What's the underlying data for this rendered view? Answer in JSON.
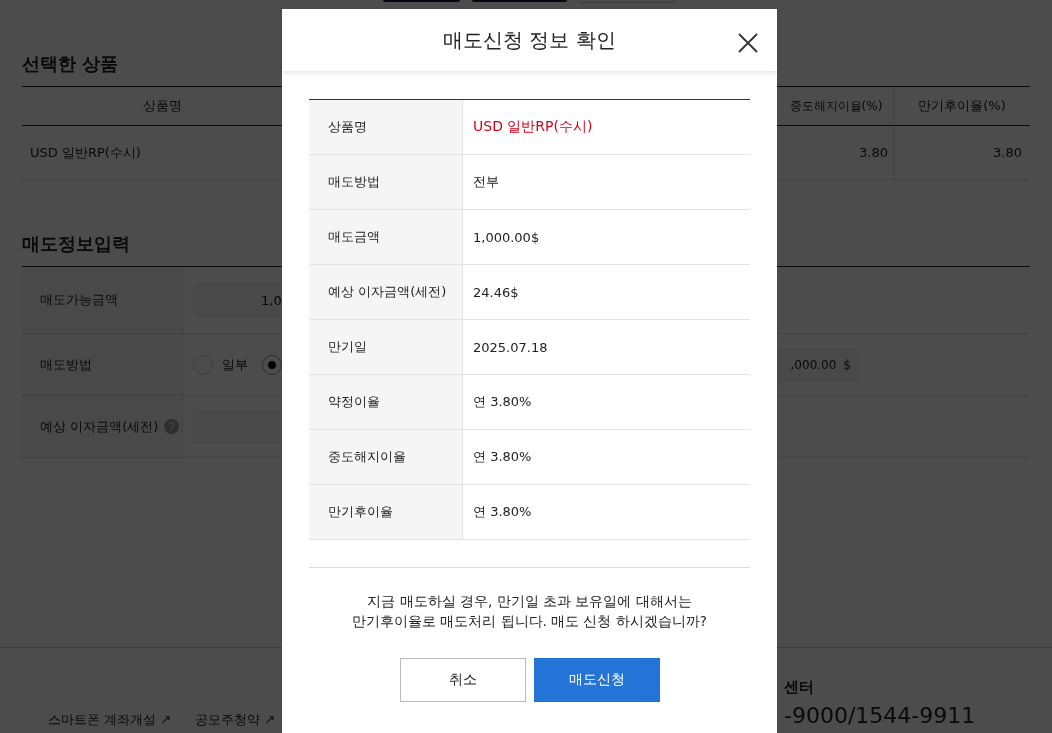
{
  "background_page": {
    "product_section": {
      "title": "선택한 상품",
      "columns": [
        "상품명",
        "중도해지이율(%)",
        "만기후이율(%)"
      ],
      "rows": [
        {
          "name": "USD 일반RP(수시)",
          "early_rate": "3.80",
          "after_rate": "3.80"
        }
      ]
    },
    "input_section": {
      "title": "매도정보입력",
      "available_amount": {
        "label": "매도가능금액",
        "value": "1,0"
      },
      "sell_method": {
        "label": "매도방법",
        "options": [
          {
            "label": "일부",
            "selected": false
          },
          {
            "selected": true
          }
        ],
        "amount": ",000.00",
        "unit": "$"
      },
      "expected_interest": {
        "label": "예상 이자금액(세전)"
      }
    },
    "footer": {
      "links": [
        "스마트폰 계좌개설 ↗",
        "공모주청약 ↗"
      ],
      "center_title": "센터",
      "phone": "-9000/1544-9911"
    }
  },
  "dialog": {
    "title": "매도신청 정보 확인",
    "rows": [
      {
        "label": "상품명",
        "value": "USD 일반RP(수시)",
        "emphasis": true
      },
      {
        "label": "매도방법",
        "value": "전부",
        "emphasis": false
      },
      {
        "label": "매도금액",
        "value": "1,000.00$",
        "emphasis": false
      },
      {
        "label": "예상 이자금액(세전)",
        "value": "24.46$",
        "emphasis": false
      },
      {
        "label": "만기일",
        "value": "2025.07.18",
        "emphasis": false
      },
      {
        "label": "약정이율",
        "value": "연 3.80%",
        "emphasis": false
      },
      {
        "label": "중도해지이율",
        "value": "연 3.80%",
        "emphasis": false
      },
      {
        "label": "만기후이율",
        "value": "연 3.80%",
        "emphasis": false
      }
    ],
    "message_lines": [
      "지금 매도하실 경우, 만기일 초과 보유일에 대해서는",
      "만기후이율로 매도처리 됩니다. 매도 신청 하시겠습니까?"
    ],
    "buttons": [
      {
        "label": "취소",
        "kind": "secondary"
      },
      {
        "label": "매도신청",
        "kind": "primary"
      }
    ]
  }
}
